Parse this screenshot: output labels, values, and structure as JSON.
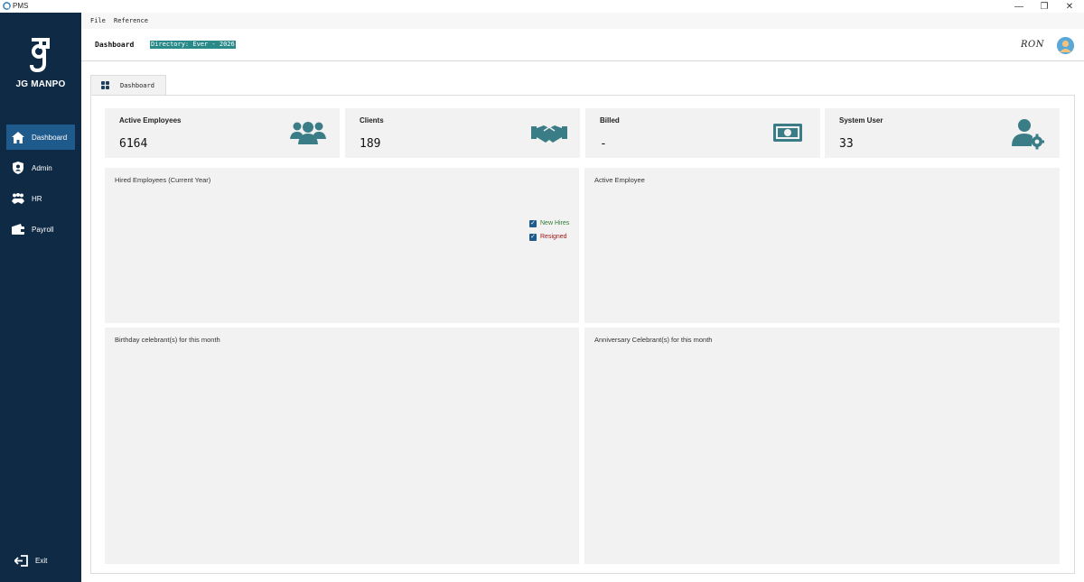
{
  "window": {
    "title": "PMS",
    "controls": {
      "minimize": "—",
      "maximize": "❐",
      "close": "✕"
    }
  },
  "sidebar": {
    "brand": "JG MANPO",
    "items": [
      {
        "label": "Dashboard",
        "icon": "home-icon",
        "active": true
      },
      {
        "label": "Admin",
        "icon": "shield-user-icon",
        "active": false
      },
      {
        "label": "HR",
        "icon": "handshake-people-icon",
        "active": false
      },
      {
        "label": "Payroll",
        "icon": "wallet-icon",
        "active": false
      }
    ],
    "exit_label": "Exit"
  },
  "menubar": {
    "items": [
      "File",
      "Reference"
    ]
  },
  "header": {
    "title": "Dashboard",
    "directory": "Directory: Ever - 2026",
    "user": "RON"
  },
  "tabs": [
    {
      "label": "Dashboard"
    }
  ],
  "cards": [
    {
      "label": "Active Employees",
      "value": "6164",
      "icon": "users-group-icon"
    },
    {
      "label": "Clients",
      "value": "189",
      "icon": "handshake-icon"
    },
    {
      "label": "Billed",
      "value": "-",
      "icon": "money-bill-icon"
    },
    {
      "label": "System User",
      "value": "33",
      "icon": "user-gear-icon"
    }
  ],
  "panels": {
    "hired": {
      "title": "Hired Employees (Current Year)",
      "legend": [
        {
          "name": "New Hires",
          "color": "#2e7d32"
        },
        {
          "name": "Resigned",
          "color": "#a01818"
        }
      ]
    },
    "active": {
      "title": "Active Employee"
    },
    "birthday": {
      "title": "Birthday celebrant(s) for this month"
    },
    "anniversary": {
      "title": "Anniversary Celebrant(s) for this month"
    }
  },
  "colors": {
    "sidebar_bg": "#0f2a45",
    "sidebar_active": "#1f5a8c",
    "icon_teal": "#3a7d86",
    "directory_bg": "#2a8a8a"
  }
}
